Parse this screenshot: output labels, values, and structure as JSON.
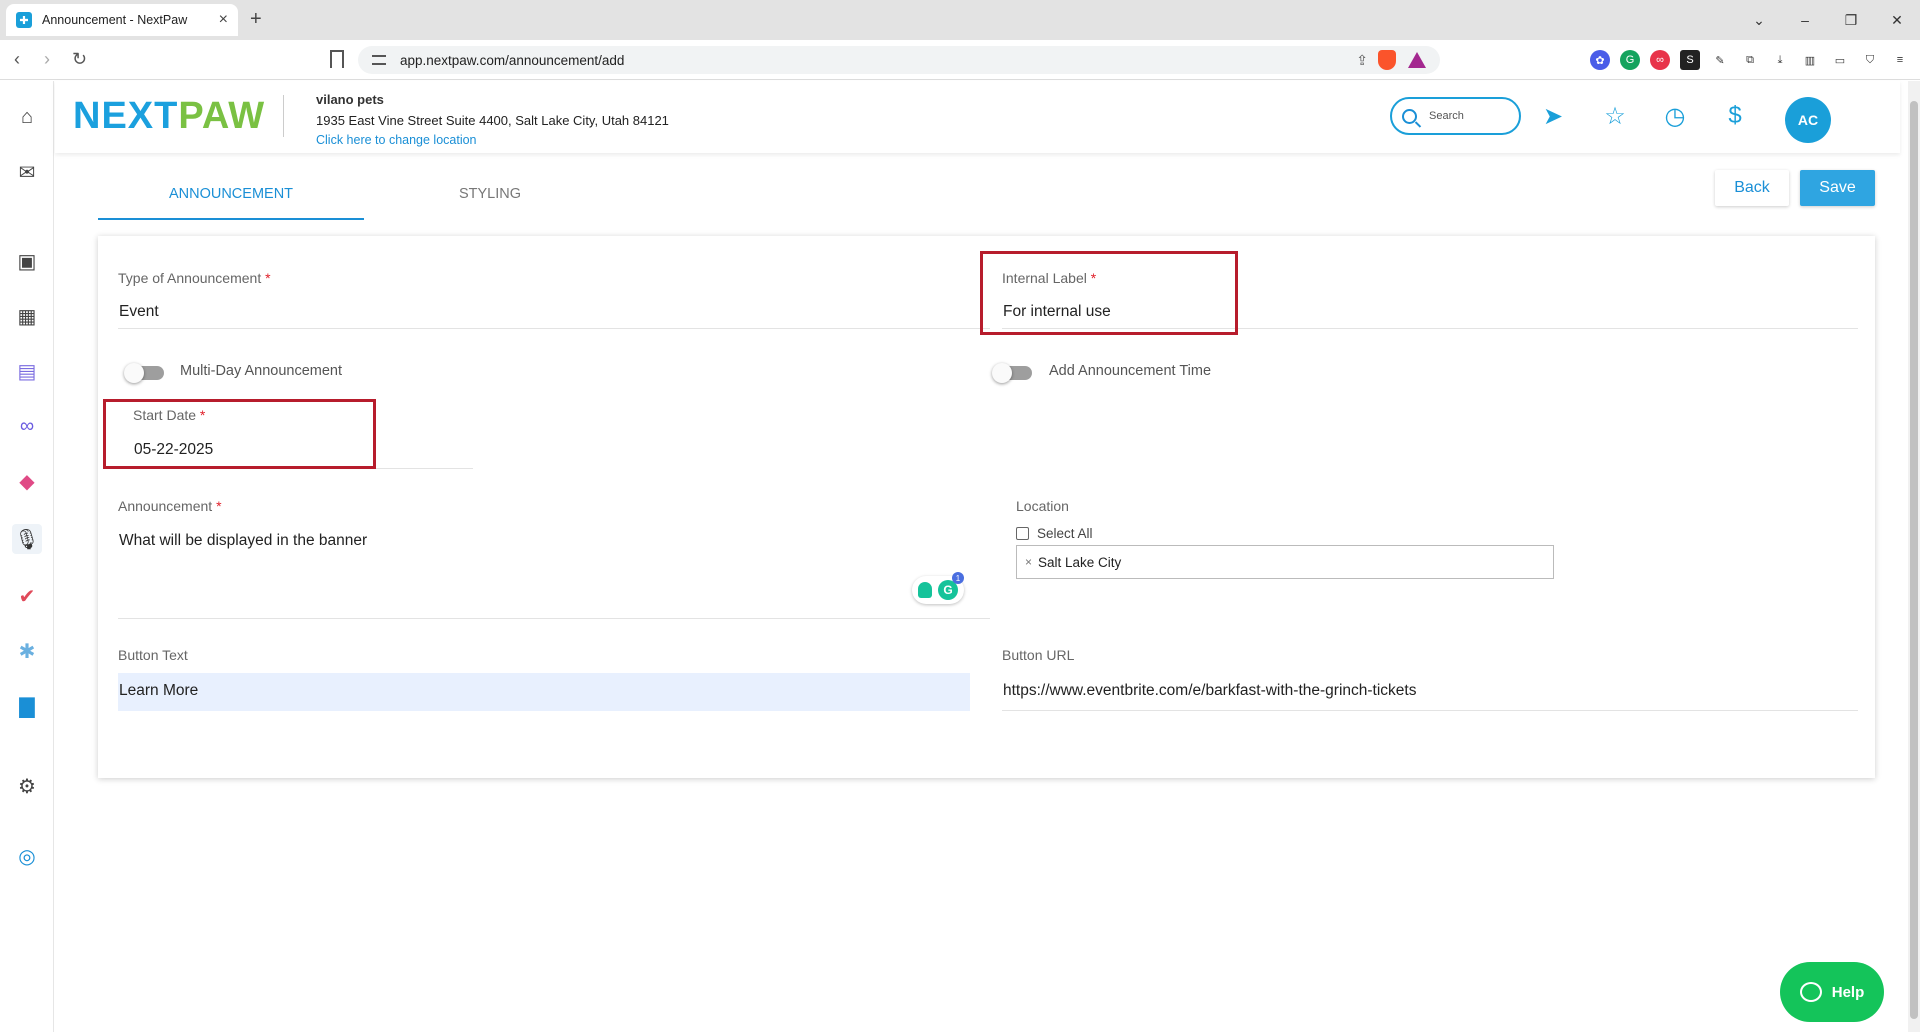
{
  "browser": {
    "tab_title": "Announcement - NextPaw",
    "url": "app.nextpaw.com/announcement/add"
  },
  "header": {
    "logo_part1": "NEXT",
    "logo_part2": "PAW",
    "business_name": "vilano pets",
    "address": "1935 East Vine Street Suite 4400, Salt Lake City, Utah 84121",
    "change_location": "Click here to change location",
    "search_placeholder": "Search",
    "avatar_initials": "AC"
  },
  "tabs": {
    "announcement": "ANNOUNCEMENT",
    "styling": "STYLING"
  },
  "actions": {
    "back": "Back",
    "save": "Save"
  },
  "form": {
    "type_label": "Type of Announcement",
    "type_value": "Event",
    "internal_label": "Internal Label",
    "internal_value": "For internal use",
    "multi_day_label": "Multi-Day Announcement",
    "multi_day_on": false,
    "add_time_label": "Add Announcement Time",
    "add_time_on": false,
    "start_date_label": "Start Date",
    "start_date_value": "05-22-2025",
    "announcement_label": "Announcement",
    "announcement_value": "What will be displayed in the banner",
    "location_label": "Location",
    "select_all_label": "Select All",
    "location_chip": "Salt Lake City",
    "button_text_label": "Button Text",
    "button_text_value": "Learn More",
    "button_url_label": "Button URL",
    "button_url_value": "https://www.eventbrite.com/e/barkfast-with-the-grinch-tickets",
    "required_mark": "*",
    "grammarly_badge": "1"
  },
  "help": {
    "label": "Help"
  },
  "colors": {
    "brand_blue": "#1ba0de",
    "brand_green": "#7ac143",
    "highlight_red": "#b71c2c",
    "help_green": "#14c45a"
  }
}
